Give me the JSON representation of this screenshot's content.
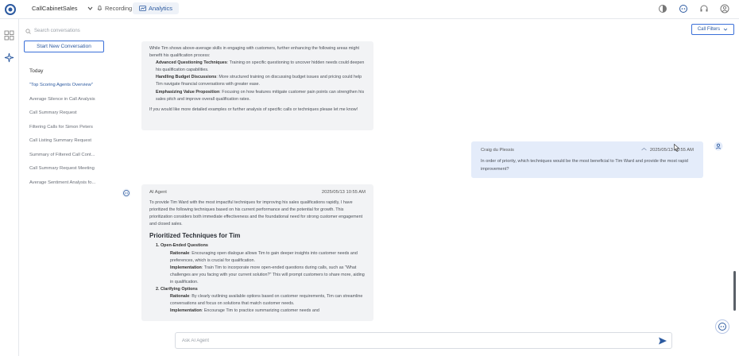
{
  "header": {
    "app_name": "CallCabinetSales",
    "tabs": [
      {
        "label": "Recording",
        "icon": "microphone-icon"
      },
      {
        "label": "Analytics",
        "icon": "chart-icon"
      }
    ],
    "icons": [
      "contrast-icon",
      "ai-agent-icon",
      "headset-icon",
      "user-icon"
    ]
  },
  "sidebar": {
    "search_placeholder": "Search conversations",
    "new_conversation_label": "Start New Conversation",
    "section_label": "Today",
    "conversations": [
      "\"Top Scoring Agents Overview\"",
      "Average Silence in Call Analysis",
      "Call Summary Request",
      "Filtering Calls for Simon Peters",
      "Call Listing Summary Request",
      "Summary of Filtered Call Cont...",
      "Call Summary Request Meeting",
      "Average Sentiment Analysis fo..."
    ]
  },
  "main": {
    "filters_label": "Call Filters",
    "message1": {
      "intro": "While Tim shows above-average skills in engaging with customers, further enhancing the following areas might benefit his qualification process:",
      "points": [
        {
          "title": "Advanced Questioning Techniques",
          "text": ": Training on specific questioning to uncover hidden needs could deepen his qualification capabilities."
        },
        {
          "title": "Handling Budget Discussions",
          "text": ": More structured training on discussing budget issues and pricing could help Tim navigate financial conversations with greater ease."
        },
        {
          "title": "Emphasizing Value Proposition",
          "text": ": Focusing on how features mitigate customer pain points can strengthen his sales pitch and improve overall qualification rates."
        }
      ],
      "closing": "If you would like more detailed examples or further analysis of specific calls or techniques please let me know!"
    },
    "user_message": {
      "author": "Craig du Plessis",
      "timestamp": "2025/05/13 10:55 AM",
      "text": "In order of priority, which techniques would be the most beneficial to Tim Ward and provide the most rapid improvement?"
    },
    "ai_message": {
      "author": "AI Agent",
      "timestamp": "2025/05/13 10:55 AM",
      "intro": "To provide Tim Ward with the most impactful techniques for improving his sales qualifications rapidly, I have prioritized the following techniques based on his current performance and the potential for growth. This prioritization considers both immediate effectiveness and the foundational need for strong customer engagement and closed sales.",
      "heading": "Prioritized Techniques for Tim",
      "items": [
        {
          "title": "1. Open-Ended Questions",
          "rationale_label": "Rationale",
          "rationale": ": Encouraging open dialogue allows Tim to gain deeper insights into customer needs and preferences, which is crucial for qualification.",
          "impl_label": "Implementation",
          "impl": ": Train Tim to incorporate more open-ended questions during calls, such as \"What challenges are you facing with your current solution?\" This will prompt customers to share more, aiding in qualification."
        },
        {
          "title": "2. Clarifying Options",
          "rationale_label": "Rationale",
          "rationale": ": By clearly outlining available options based on customer requirements, Tim can streamline conversations and focus on solutions that match customer needs.",
          "impl_label": "Implementation",
          "impl": ": Encourage Tim to practice summarizing customer needs and"
        }
      ]
    },
    "input_placeholder": "Ask AI Agent"
  }
}
